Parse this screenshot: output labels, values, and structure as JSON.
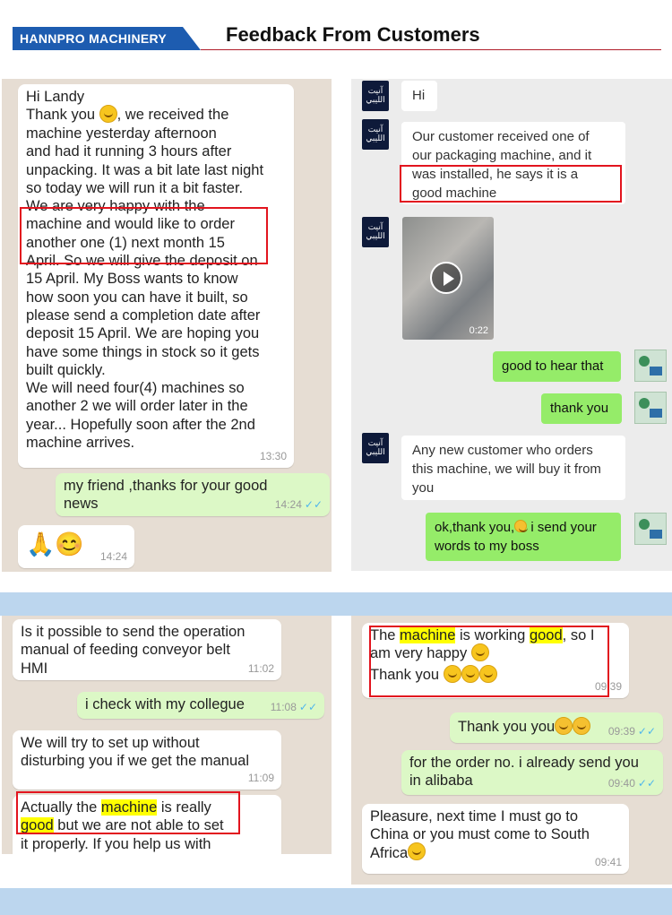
{
  "header": {
    "brand": "HANNPRO MACHINERY",
    "title": "Feedback From Customers"
  },
  "colors": {
    "brand_blue": "#1d5cb0",
    "highlight_red": "#e2141e",
    "whatsapp_green": "#dcf8c6",
    "wechat_green": "#95ec69",
    "band_blue": "#bcd6ee"
  },
  "panel1": {
    "msg1": {
      "lines": [
        "Hi Landy",
        " Thank you",
        "machine yesterday afternoon",
        "and had it running 3 hours after",
        "unpacking. It was a bit late last night",
        "so today we will run it a bit faster.",
        "We are very happy with the",
        "machine and would like to order",
        "another one (1) next month 15",
        "April. So we will give the deposit on",
        "15 April. My Boss wants to know",
        "how soon you can have it built, so",
        "please send a completion date after",
        "deposit 15 April. We are hoping you",
        "have some things in stock so it gets",
        "built quickly.",
        "We will need four(4) machines so",
        "another 2 we will order later in the",
        "year... Hopefully soon after the 2nd",
        "machine arrives."
      ],
      "thank_suffix": ", we received the",
      "time": "13:30"
    },
    "msg2": {
      "lines": [
        "my friend ,thanks for your good",
        "news"
      ],
      "time": "14:24"
    },
    "msg3": {
      "emoji": "🙏😊",
      "time": "14:24"
    }
  },
  "panel2": {
    "avatar_text": "آنيت الليبي",
    "msg1": "Hi",
    "msg2": [
      "Our customer received one of",
      "our packaging machine, and it",
      "was installed, he says it is a",
      "good machine"
    ],
    "video_time": "0:22",
    "msg3": "good to hear that",
    "msg4": "thank you",
    "msg5": [
      "Any new customer who orders",
      "this machine, we will buy it from",
      "you"
    ],
    "msg6": [
      "ok,thank you,",
      " i send your",
      "words to my boss"
    ]
  },
  "panel3": {
    "msg1": {
      "lines": [
        "Is it possible to send the operation",
        "manual of feeding conveyor belt",
        "HMI"
      ],
      "time": "11:02"
    },
    "msg2": {
      "text": "i check with my collegue",
      "time": "11:08"
    },
    "msg3": {
      "lines": [
        "We will try to set up without",
        "disturbing you if we get the manual"
      ],
      "time": "11:09"
    },
    "msg4": {
      "pre": "Actually the ",
      "hl1": "machine",
      "mid": " is really",
      "hl2": "good",
      "post": " but we are not able to set",
      "line3": "it properly. If you help us with"
    }
  },
  "panel4": {
    "msg1": {
      "pre": "The ",
      "hl1": "machine",
      "mid": " is working ",
      "hl2": "good",
      "post": ", so I",
      "line2": "am very happy",
      "line3": "Thank you",
      "time": "09:39"
    },
    "msg2": {
      "text": "Thank you you",
      "time": "09:39"
    },
    "msg3": {
      "lines": [
        "for the order no. i already send you",
        "in alibaba"
      ],
      "time": "09:40"
    },
    "msg4": {
      "lines": [
        "Pleasure, next time I must go to",
        "China or you must come to South",
        "Africa"
      ],
      "time": "09:41"
    }
  }
}
